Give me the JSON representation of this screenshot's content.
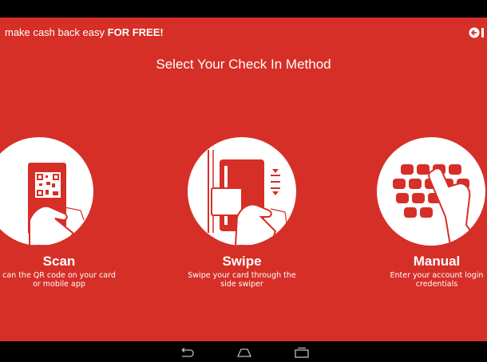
{
  "topbar": {
    "tagline_prefix": "make cash back easy",
    "tagline_bold": "FOR FREE!",
    "back_icon": "arrow-left-circle-icon"
  },
  "title": "Select Your Check In Method",
  "methods": [
    {
      "label": "Scan",
      "description": "can the QR code on your card or mobile app",
      "icon": "qr-card-icon"
    },
    {
      "label": "Swipe",
      "description": "Swipe your card through the side swiper",
      "icon": "card-swipe-icon"
    },
    {
      "label": "Manual",
      "description": "Enter your account login credentials",
      "icon": "keyboard-icon"
    }
  ],
  "colors": {
    "background": "#d62f27",
    "text": "#ffffff"
  },
  "nav_icons": [
    "back-icon",
    "home-icon",
    "recents-icon"
  ]
}
